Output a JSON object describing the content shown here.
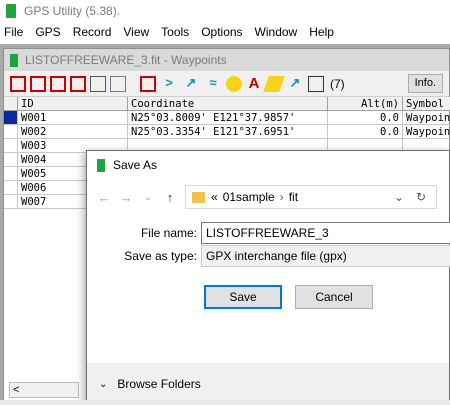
{
  "app": {
    "title": "GPS Utility (5.38).",
    "menu": [
      "File",
      "GPS",
      "Record",
      "View",
      "Tools",
      "Options",
      "Window",
      "Help"
    ]
  },
  "child_window": {
    "title": "LISTOFFREEWARE_3.fit - Waypoints",
    "count": "(7)",
    "info_label": "Info.",
    "columns": [
      "ID",
      "Coordinate",
      "Alt(m)",
      "Symbol"
    ],
    "rows": [
      {
        "id": "W001",
        "coord": "N25°03.8009' E121°37.9857'",
        "alt": "0.0",
        "symbol": "Waypoint"
      },
      {
        "id": "W002",
        "coord": "N25°03.3354' E121°37.6951'",
        "alt": "0.0",
        "symbol": "Waypoint"
      },
      {
        "id": "W003",
        "coord": "",
        "alt": "",
        "symbol": ""
      },
      {
        "id": "W004",
        "coord": "",
        "alt": "",
        "symbol": ""
      },
      {
        "id": "W005",
        "coord": "",
        "alt": "",
        "symbol": ""
      },
      {
        "id": "W006",
        "coord": "",
        "alt": "",
        "symbol": ""
      },
      {
        "id": "W007",
        "coord": "",
        "alt": "",
        "symbol": ""
      }
    ],
    "scroll_left": "<"
  },
  "dialog": {
    "title": "Save As",
    "path_prefix": "«",
    "path": [
      "01sample",
      "fit"
    ],
    "file_name_label": "File name:",
    "file_name_value": "LISTOFFREEWARE_3",
    "save_type_label": "Save as type:",
    "save_type_value": "GPX interchange file (gpx)",
    "save_label": "Save",
    "cancel_label": "Cancel",
    "browse_label": "Browse Folders"
  },
  "colors": {
    "app_icon": "#1fa33b",
    "selection": "#0a2a9c",
    "primary_border": "#0078d7",
    "folder": "#f2c04d"
  }
}
